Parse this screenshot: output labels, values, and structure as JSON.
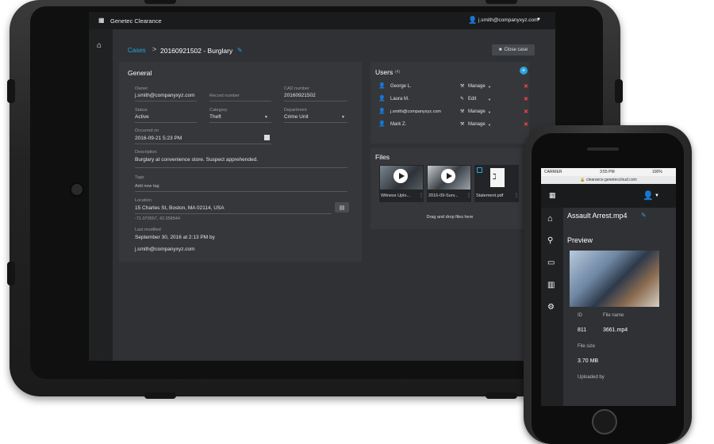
{
  "tablet": {
    "app_name": "Genetec Clearance",
    "user_email": "j.smith@companyxyz.com",
    "breadcrumb": {
      "root": "Cases",
      "separator": ">",
      "case_title": "20160921502 - Burglary"
    },
    "close_case_label": "Close case",
    "general": {
      "heading": "General",
      "owner_label": "Owner",
      "owner_value": "j.smith@companyxyz.com",
      "record_number_label": "Record number",
      "cad_number_label": "CAD number",
      "cad_number_value": "20160921502",
      "status_label": "Status",
      "status_value": "Active",
      "category_label": "Category",
      "category_value": "Theft",
      "department_label": "Department",
      "department_value": "Crime Unit",
      "occurred_label": "Occurred on",
      "occurred_value": "2016-09-21 5:23 PM",
      "description_label": "Description",
      "description_value": "Burglary at convenience store. Suspect apprehended.",
      "tags_label": "Tags",
      "tags_placeholder": "Add new tag",
      "location_label": "Location",
      "location_value": "15 Charles St, Boston, MA 02114, USA",
      "coordinates": "-71.070557, 42.358544",
      "last_modified_label": "Last modified",
      "last_modified_value": "September 30, 2016 at 2:13 PM by",
      "last_modified_by": "j.smith@companyxyz.com"
    },
    "users": {
      "heading": "Users",
      "count": "(4)",
      "rows": [
        {
          "name": "George L.",
          "role": "Manage"
        },
        {
          "name": "Laura M.",
          "role": "Edit"
        },
        {
          "name": "j.smith@companyxyz.com",
          "role": "Manage"
        },
        {
          "name": "Mark Z.",
          "role": "Manage"
        }
      ]
    },
    "files": {
      "heading": "Files",
      "items": [
        "Witness Uplo...",
        "2016-09-Surv...",
        "Statement.pdf"
      ],
      "drop_text": "Drag and drop files here"
    }
  },
  "phone": {
    "carrier": "CARRIER",
    "time": "3:55 PM",
    "battery": "100%",
    "url": "clearance.geneteccloud.com",
    "file_title": "Assault Arrest.mp4",
    "preview_label": "Preview",
    "id_label": "ID",
    "id_value": "811",
    "filename_label": "File name",
    "filename_value": "3661.mp4",
    "filesize_label": "File size",
    "filesize_value": "3.70 MB",
    "uploaded_label": "Uploaded by"
  },
  "colors": {
    "accent": "#29a3e0",
    "delete": "#e0443e",
    "panel": "#35373a",
    "screen": "#2f3134"
  }
}
